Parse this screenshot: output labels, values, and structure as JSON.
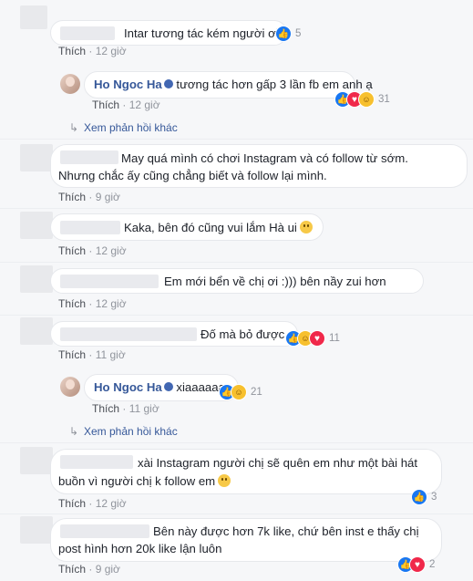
{
  "meta": {
    "like_label": "Thích",
    "see_replies": "Xem phản hồi khác"
  },
  "comments": [
    {
      "text": "Intar tương tác kém người ơi.",
      "time": "12 giờ",
      "reactions": "5"
    },
    {
      "name": "Ho Ngoc Ha",
      "text": "tương tác hơn gấp 3 lần fb em anh ạ",
      "time": "12 giờ",
      "reactions": "31"
    },
    {
      "text": "May quá mình có chơi Instagram và có follow từ sớm. Nhưng chắc ấy cũng chẳng biết và follow lại mình.",
      "line1": "May quá mình có chơi Instagram và có follow từ sớm.",
      "line2": "Nhưng chắc ấy cũng chẳng biết và follow lại mình.",
      "time": "9 giờ"
    },
    {
      "text": "Kaka, bên đó cũng vui lắm Hà ui",
      "time": "12 giờ"
    },
    {
      "text": "Em mới bển về chị ơi :))) bên nầy zui hơn",
      "time": "12 giờ"
    },
    {
      "text": "Đố mà bỏ được",
      "time": "11 giờ",
      "reactions": "11"
    },
    {
      "name": "Ho Ngoc Ha",
      "text": "xiaaaaaaa",
      "time": "11 giờ",
      "reactions": "21"
    },
    {
      "line1": "xài Instagram người chị sẽ quên em như một bài hát",
      "line2": "buồn vì người chị k follow em",
      "time": "12 giờ",
      "reactions": "3"
    },
    {
      "line1": "Bên này được hơn 7k like, chứ bên inst e thấy chị",
      "line2": "post hình hơn 20k like lận luôn",
      "time": "9 giờ",
      "reactions": "2"
    }
  ]
}
